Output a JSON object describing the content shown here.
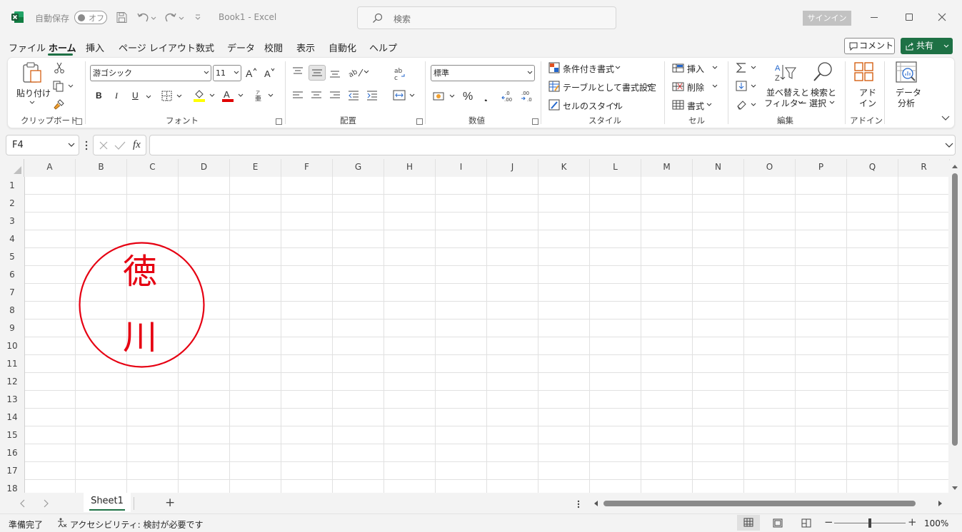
{
  "titlebar": {
    "autosave_label": "自動保存",
    "autosave_state": "オフ",
    "title": "Book1  -  Excel",
    "search_placeholder": "検索",
    "signin": "サインイン"
  },
  "menu": {
    "tabs": [
      "ファイル",
      "ホーム",
      "挿入",
      "ページ レイアウト",
      "数式",
      "データ",
      "校閲",
      "表示",
      "自動化",
      "ヘルプ"
    ],
    "active": "ホーム",
    "comment": "コメント",
    "share": "共有"
  },
  "ribbon": {
    "clipboard": {
      "paste": "貼り付け",
      "label": "クリップボード"
    },
    "font": {
      "name": "游ゴシック",
      "size": "11",
      "bold": "B",
      "italic": "I",
      "underline": "U",
      "label": "フォント"
    },
    "alignment": {
      "label": "配置"
    },
    "number": {
      "format": "標準",
      "label": "数値"
    },
    "styles": {
      "conditional": "条件付き書式",
      "table": "テーブルとして書式設定",
      "cell_styles": "セルのスタイル",
      "label": "スタイル"
    },
    "cells": {
      "insert": "挿入",
      "delete": "削除",
      "format": "書式",
      "label": "セル"
    },
    "editing": {
      "sort": "並べ替えと",
      "sort2": "フィルター",
      "find": "検索と",
      "find2": "選択",
      "label": "編集"
    },
    "addins": {
      "line1": "アド",
      "line2": "イン",
      "label": "アドイン"
    },
    "analysis": {
      "line1": "データ",
      "line2": "分析"
    }
  },
  "formula_bar": {
    "name_box": "F4",
    "fx": "fx",
    "formula": ""
  },
  "grid": {
    "columns": [
      "A",
      "B",
      "C",
      "D",
      "E",
      "F",
      "G",
      "H",
      "I",
      "J",
      "K",
      "L",
      "M",
      "N",
      "O",
      "P",
      "Q",
      "R"
    ],
    "rows": [
      "1",
      "2",
      "3",
      "4",
      "5",
      "6",
      "7",
      "8",
      "9",
      "10",
      "11",
      "12",
      "13",
      "14",
      "15",
      "16",
      "17",
      "18"
    ],
    "stamp": {
      "char1": "徳",
      "char2": "川",
      "color": "#e60012"
    }
  },
  "sheets": {
    "tabs": [
      "Sheet1"
    ],
    "active": "Sheet1",
    "add": "+"
  },
  "status": {
    "ready": "準備完了",
    "accessibility": "アクセシビリティ: 検討が必要です",
    "zoom": "100%"
  },
  "colors": {
    "accent": "#1e7145",
    "stamp_red": "#e60012"
  }
}
